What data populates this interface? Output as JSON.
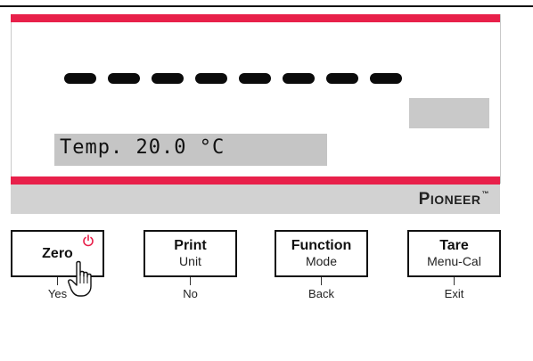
{
  "display": {
    "temp_text": "Temp. 20.0 °C",
    "brand": {
      "initial": "P",
      "rest": "IONEER",
      "tm": "™"
    }
  },
  "keys": [
    {
      "main": "Zero",
      "sub": "",
      "label": "Yes",
      "icon": "power-icon"
    },
    {
      "main": "Print",
      "sub": "Unit",
      "label": "No"
    },
    {
      "main": "Function",
      "sub": "Mode",
      "label": "Back"
    },
    {
      "main": "Tare",
      "sub": "Menu-Cal",
      "label": "Exit"
    }
  ],
  "colors": {
    "accent": "#e8204a",
    "panel_gray": "#c5c5c5",
    "strip_gray": "#d2d2d2"
  },
  "cursor": "hand-pointer-icon"
}
